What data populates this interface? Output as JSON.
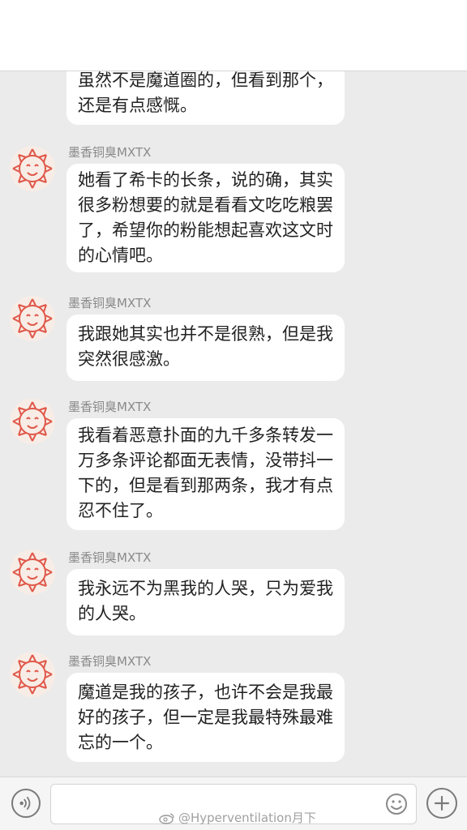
{
  "messages": [
    {
      "sender": "",
      "text": "虽然不是魔道圈的，但看到那个，\n还是有点感慨。"
    },
    {
      "sender": "墨香铜臭MXTX",
      "text": "她看了希卡的长条，说的确，其实\n很多粉想要的就是看看文吃吃粮罢\n了，希望你的粉能想起喜欢这文时\n的心情吧。"
    },
    {
      "sender": "墨香铜臭MXTX",
      "text": "我跟她其实也并不是很熟，但是我\n突然很感激。"
    },
    {
      "sender": "墨香铜臭MXTX",
      "text": "我看着恶意扑面的九千多条转发一\n万多条评论都面无表情，没带抖一\n下的，但是看到那两条，我才有点\n忍不住了。"
    },
    {
      "sender": "墨香铜臭MXTX",
      "text": "我永远不为黑我的人哭，只为爱我\n的人哭。"
    },
    {
      "sender": "墨香铜臭MXTX",
      "text": "魔道是我的孩子，也许不会是我最\n好的孩子，但一定是我最特殊最难\n忘的一个。"
    }
  ],
  "input_bar": {
    "voice_icon": "voice-wave-icon",
    "emoji_icon": "smiley-icon",
    "plus_icon": "plus-icon"
  },
  "watermark": {
    "text": "@Hyperventilation月下"
  },
  "colors": {
    "background": "#ebebeb",
    "bubble": "#ffffff",
    "avatar_petals": "#e0584a"
  }
}
